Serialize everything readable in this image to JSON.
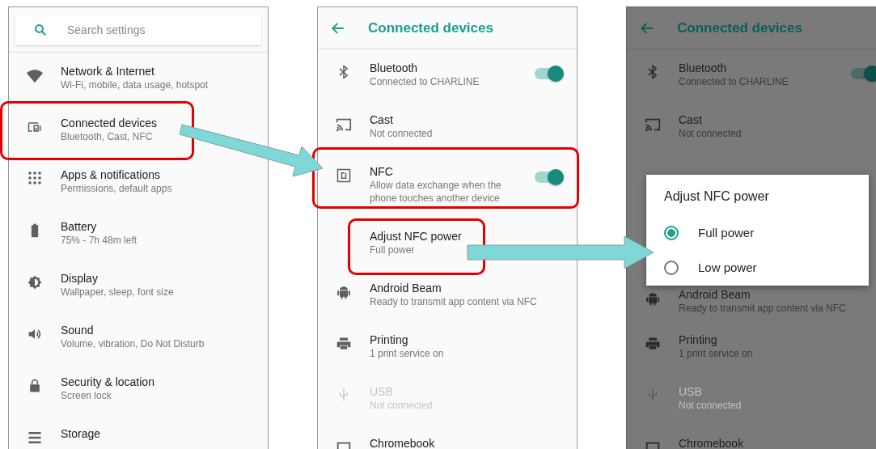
{
  "settings": {
    "search": {
      "placeholder": "Search settings"
    },
    "items": [
      {
        "kind": "wifi",
        "title": "Network & Internet",
        "subtitle": "Wi-Fi, mobile, data usage, hotspot"
      },
      {
        "kind": "devices",
        "title": "Connected devices",
        "subtitle": "Bluetooth, Cast, NFC"
      },
      {
        "kind": "apps",
        "title": "Apps & notifications",
        "subtitle": "Permissions, default apps"
      },
      {
        "kind": "battery",
        "title": "Battery",
        "subtitle": "75% - 7h 48m left"
      },
      {
        "kind": "display",
        "title": "Display",
        "subtitle": "Wallpaper, sleep, font size"
      },
      {
        "kind": "sound",
        "title": "Sound",
        "subtitle": "Volume, vibration, Do Not Disturb"
      },
      {
        "kind": "lock",
        "title": "Security & location",
        "subtitle": "Screen lock"
      },
      {
        "kind": "storage",
        "title": "Storage"
      }
    ]
  },
  "connected_devices": {
    "title": "Connected devices",
    "items": [
      {
        "kind": "bluetooth",
        "title": "Bluetooth",
        "subtitle": "Connected to CHARLINE",
        "disabled": false,
        "toggle": {
          "on": true
        }
      },
      {
        "kind": "cast",
        "title": "Cast",
        "subtitle": "Not connected",
        "disabled": false
      },
      {
        "kind": "nfc",
        "title": "NFC",
        "subtitle": "Allow data exchange when the phone touches another device",
        "disabled": false,
        "toggle": {
          "on": true
        }
      },
      {
        "kind": "plain",
        "title": "Adjust NFC power",
        "subtitle": "Full power",
        "disabled": false
      },
      {
        "kind": "android",
        "title": "Android Beam",
        "subtitle": "Ready to transmit app content via NFC",
        "disabled": false
      },
      {
        "kind": "printer",
        "title": "Printing",
        "subtitle": "1 print service on",
        "disabled": false
      },
      {
        "kind": "usb",
        "title": "USB",
        "subtitle": "Not connected",
        "disabled": true
      },
      {
        "kind": "laptop",
        "title": "Chromebook",
        "disabled": false
      }
    ]
  },
  "dimmed_screen": {
    "title": "Connected devices",
    "items_above": [
      {
        "kind": "bluetooth",
        "title": "Bluetooth",
        "subtitle": "Connected to CHARLINE",
        "disabled": false,
        "toggle": {
          "on": true
        }
      },
      {
        "kind": "cast",
        "title": "Cast",
        "subtitle": "Not connected",
        "disabled": false
      }
    ],
    "dialog": {
      "title": "Adjust NFC power",
      "options": [
        {
          "label": "Full power",
          "selected": true
        },
        {
          "label": "Low power",
          "selected": false
        }
      ]
    },
    "items_below": [
      {
        "kind": "android",
        "title": "Android Beam",
        "subtitle": "Ready to transmit app content via NFC",
        "disabled": false
      },
      {
        "kind": "printer",
        "title": "Printing",
        "subtitle": "1 print service on",
        "disabled": false
      },
      {
        "kind": "usb",
        "title": "USB",
        "subtitle": "Not connected",
        "disabled": true
      },
      {
        "kind": "laptop",
        "title": "Chromebook",
        "disabled": false
      }
    ]
  }
}
